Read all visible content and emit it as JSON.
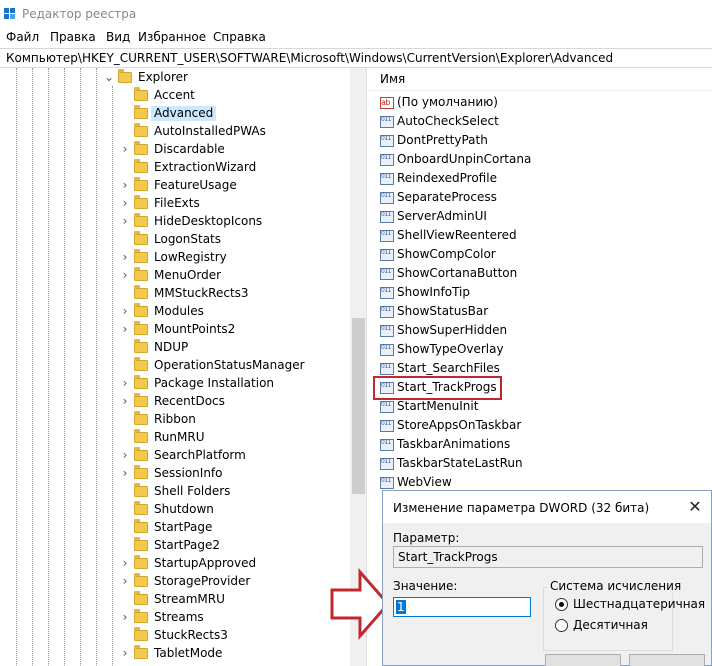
{
  "window": {
    "title": "Редактор реестра"
  },
  "menu": [
    "Файл",
    "Правка",
    "Вид",
    "Избранное",
    "Справка"
  ],
  "address": "Компьютер\\HKEY_CURRENT_USER\\SOFTWARE\\Microsoft\\Windows\\CurrentVersion\\Explorer\\Advanced",
  "tree": {
    "parent": "Explorer",
    "items": [
      {
        "label": "Accent",
        "expandable": false,
        "selected": false
      },
      {
        "label": "Advanced",
        "expandable": false,
        "selected": true
      },
      {
        "label": "AutoInstalledPWAs",
        "expandable": false,
        "selected": false
      },
      {
        "label": "Discardable",
        "expandable": true,
        "selected": false
      },
      {
        "label": "ExtractionWizard",
        "expandable": false,
        "selected": false
      },
      {
        "label": "FeatureUsage",
        "expandable": true,
        "selected": false
      },
      {
        "label": "FileExts",
        "expandable": true,
        "selected": false
      },
      {
        "label": "HideDesktopIcons",
        "expandable": true,
        "selected": false
      },
      {
        "label": "LogonStats",
        "expandable": false,
        "selected": false
      },
      {
        "label": "LowRegistry",
        "expandable": true,
        "selected": false
      },
      {
        "label": "MenuOrder",
        "expandable": true,
        "selected": false
      },
      {
        "label": "MMStuckRects3",
        "expandable": false,
        "selected": false
      },
      {
        "label": "Modules",
        "expandable": true,
        "selected": false
      },
      {
        "label": "MountPoints2",
        "expandable": true,
        "selected": false
      },
      {
        "label": "NDUP",
        "expandable": false,
        "selected": false
      },
      {
        "label": "OperationStatusManager",
        "expandable": false,
        "selected": false
      },
      {
        "label": "Package Installation",
        "expandable": true,
        "selected": false
      },
      {
        "label": "RecentDocs",
        "expandable": true,
        "selected": false
      },
      {
        "label": "Ribbon",
        "expandable": false,
        "selected": false
      },
      {
        "label": "RunMRU",
        "expandable": false,
        "selected": false
      },
      {
        "label": "SearchPlatform",
        "expandable": true,
        "selected": false
      },
      {
        "label": "SessionInfo",
        "expandable": true,
        "selected": false
      },
      {
        "label": "Shell Folders",
        "expandable": false,
        "selected": false
      },
      {
        "label": "Shutdown",
        "expandable": false,
        "selected": false
      },
      {
        "label": "StartPage",
        "expandable": false,
        "selected": false
      },
      {
        "label": "StartPage2",
        "expandable": false,
        "selected": false
      },
      {
        "label": "StartupApproved",
        "expandable": true,
        "selected": false
      },
      {
        "label": "StorageProvider",
        "expandable": true,
        "selected": false
      },
      {
        "label": "StreamMRU",
        "expandable": false,
        "selected": false
      },
      {
        "label": "Streams",
        "expandable": true,
        "selected": false
      },
      {
        "label": "StuckRects3",
        "expandable": false,
        "selected": false
      },
      {
        "label": "TabletMode",
        "expandable": true,
        "selected": false
      }
    ]
  },
  "values": {
    "column_name": "Имя",
    "items": [
      {
        "label": "(По умолчанию)",
        "icon": "string-value-icon",
        "highlighted": false
      },
      {
        "label": "AutoCheckSelect",
        "icon": "dword-value-icon",
        "highlighted": false
      },
      {
        "label": "DontPrettyPath",
        "icon": "dword-value-icon",
        "highlighted": false
      },
      {
        "label": "OnboardUnpinCortana",
        "icon": "dword-value-icon",
        "highlighted": false
      },
      {
        "label": "ReindexedProfile",
        "icon": "dword-value-icon",
        "highlighted": false
      },
      {
        "label": "SeparateProcess",
        "icon": "dword-value-icon",
        "highlighted": false
      },
      {
        "label": "ServerAdminUI",
        "icon": "dword-value-icon",
        "highlighted": false
      },
      {
        "label": "ShellViewReentered",
        "icon": "dword-value-icon",
        "highlighted": false
      },
      {
        "label": "ShowCompColor",
        "icon": "dword-value-icon",
        "highlighted": false
      },
      {
        "label": "ShowCortanaButton",
        "icon": "dword-value-icon",
        "highlighted": false
      },
      {
        "label": "ShowInfoTip",
        "icon": "dword-value-icon",
        "highlighted": false
      },
      {
        "label": "ShowStatusBar",
        "icon": "dword-value-icon",
        "highlighted": false
      },
      {
        "label": "ShowSuperHidden",
        "icon": "dword-value-icon",
        "highlighted": false
      },
      {
        "label": "ShowTypeOverlay",
        "icon": "dword-value-icon",
        "highlighted": false
      },
      {
        "label": "Start_SearchFiles",
        "icon": "dword-value-icon",
        "highlighted": false
      },
      {
        "label": "Start_TrackProgs",
        "icon": "dword-value-icon",
        "highlighted": true
      },
      {
        "label": "StartMenuInit",
        "icon": "dword-value-icon",
        "highlighted": false
      },
      {
        "label": "StoreAppsOnTaskbar",
        "icon": "dword-value-icon",
        "highlighted": false
      },
      {
        "label": "TaskbarAnimations",
        "icon": "dword-value-icon",
        "highlighted": false
      },
      {
        "label": "TaskbarStateLastRun",
        "icon": "dword-value-icon",
        "highlighted": false
      },
      {
        "label": "WebView",
        "icon": "dword-value-icon",
        "highlighted": false
      }
    ]
  },
  "dialog": {
    "title": "Изменение параметра DWORD (32 бита)",
    "param_label": "Параметр:",
    "param_value": "Start_TrackProgs",
    "value_label": "Значение:",
    "value": "1",
    "base_label": "Система исчисления",
    "radio_hex": "Шестнадцатеричная",
    "radio_dec": "Десятичная",
    "selected_base": "hex"
  },
  "colors": {
    "selection": "#cce8ff",
    "annotation": "#c0282d",
    "folder": "#f2c94c"
  }
}
